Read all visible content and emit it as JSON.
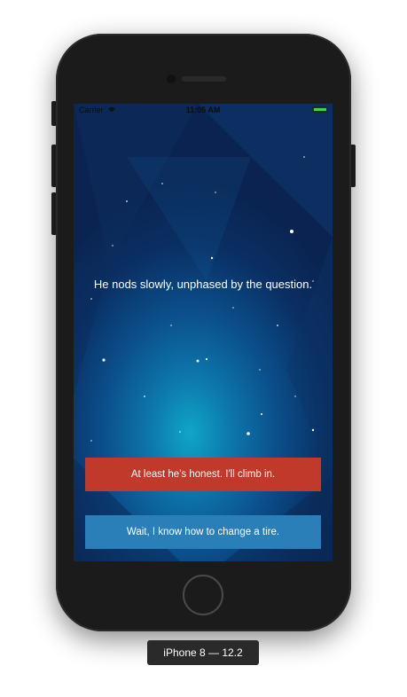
{
  "device": {
    "label": "iPhone 8 — 12.2"
  },
  "status_bar": {
    "carrier": "Carrier",
    "time": "11:05 AM"
  },
  "story": {
    "text": "He nods slowly, unphased by the question."
  },
  "choices": [
    {
      "label": "At least he's honest. I'll climb in.",
      "color": "#c0392b"
    },
    {
      "label": "Wait, I know how to change a tire.",
      "color": "#2b7fb8"
    }
  ],
  "icons": {
    "wifi": "wifi-icon",
    "battery": "battery-icon"
  }
}
